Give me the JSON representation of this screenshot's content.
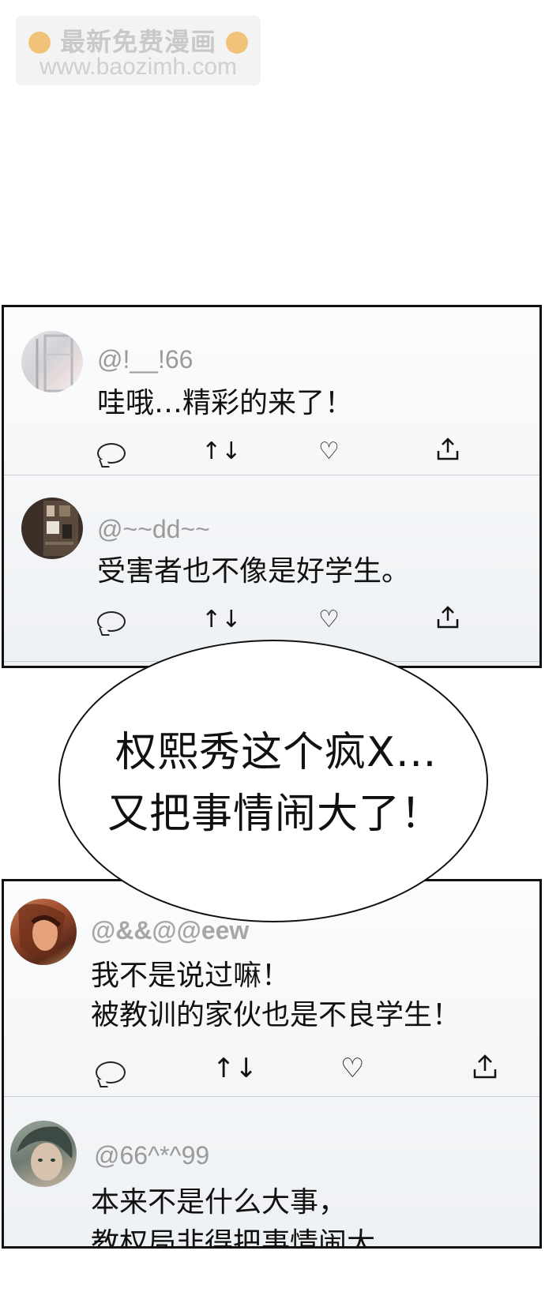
{
  "watermark": {
    "top_text": "最新免费漫画",
    "url": "www.baozimh.com"
  },
  "panel1": {
    "posts": [
      {
        "handle": "@!__!66",
        "text": "哇哦…精彩的来了！"
      },
      {
        "handle": "@~~dd~~",
        "text": "受害者也不像是好学生。"
      }
    ]
  },
  "speech_bubble": {
    "line1": "权熙秀这个疯X…",
    "line2": "又把事情闹大了！"
  },
  "panel2": {
    "posts": [
      {
        "handle": "@&&@@eew",
        "text_line1": "我不是说过嘛！",
        "text_line2": "被教训的家伙也是不良学生！"
      },
      {
        "handle": "@66^*^99",
        "text_line1": "本来不是什么大事，",
        "text_line2": "教权局非得把事情闹大"
      }
    ]
  },
  "actions": {
    "reply_icon": "comment-bubble",
    "repost_symbol": "↑↓",
    "like_symbol": "♡",
    "share_symbol": "⇧"
  },
  "colors": {
    "panel_border": "#111111",
    "handle": "#9a9a9a",
    "text": "#111111",
    "watermark": "#c9c9c9"
  }
}
